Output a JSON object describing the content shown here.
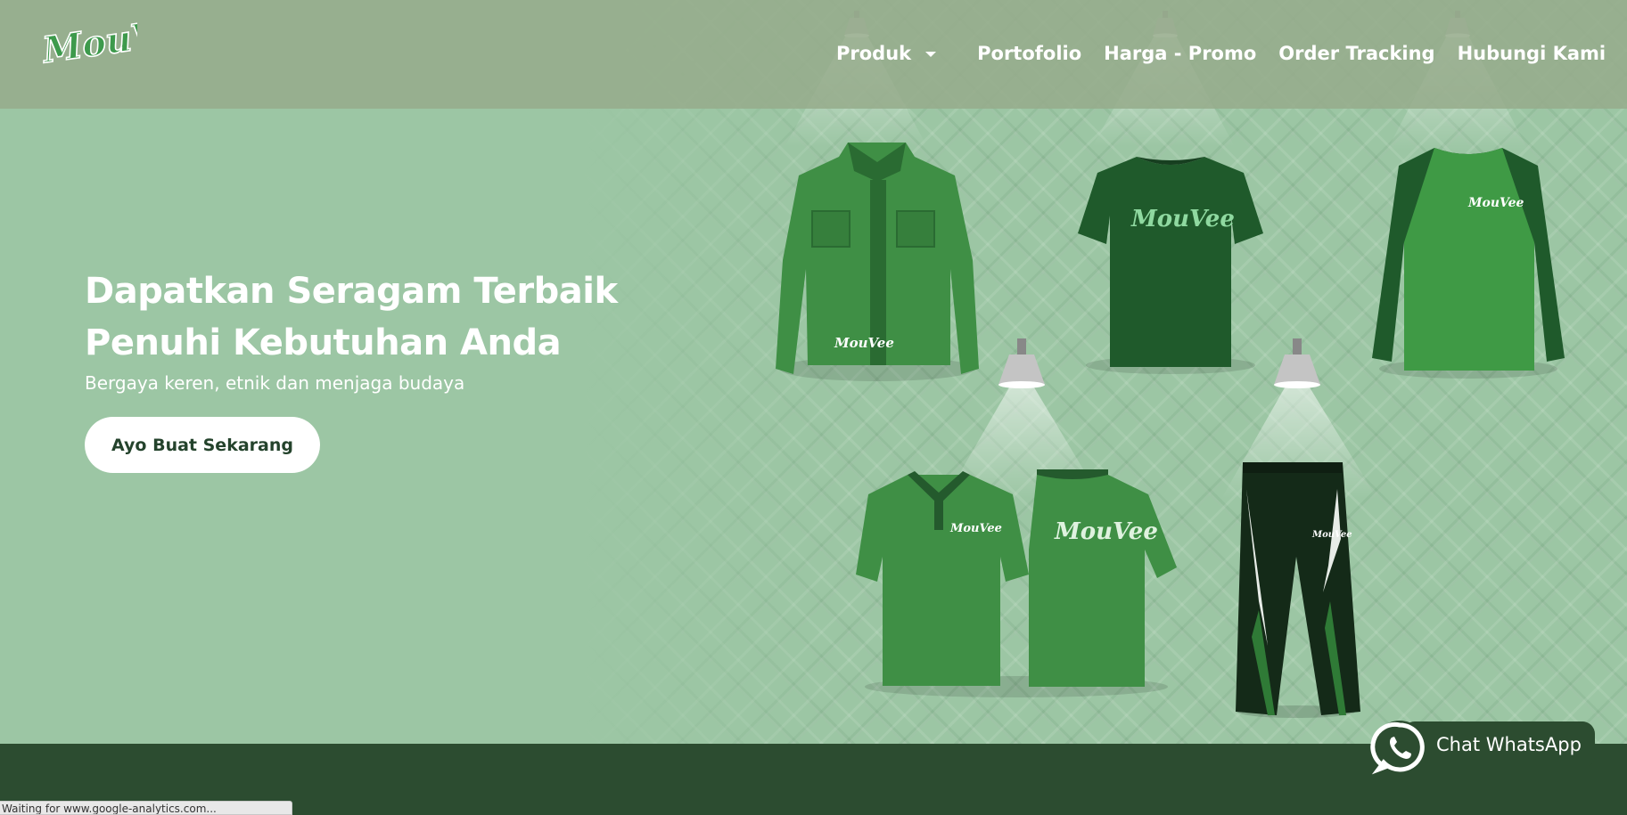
{
  "brand": {
    "logo_text": "MouVee"
  },
  "nav": {
    "items": [
      {
        "label": "Produk",
        "has_dropdown": true
      },
      {
        "label": "Portofolio"
      },
      {
        "label": "Harga - Promo"
      },
      {
        "label": "Order Tracking"
      },
      {
        "label": "Hubungi Kami"
      }
    ]
  },
  "hero": {
    "headline_line1": "Dapatkan Seragam Terbaik",
    "headline_line2": "Penuhi Kebutuhan Anda",
    "subline": "Bergaya keren, etnik dan menjaga budaya",
    "cta_label": "Ayo Buat Sekarang"
  },
  "products": {
    "print_text": "MouVee",
    "items": [
      "shirt",
      "t-shirt",
      "raglan",
      "polo",
      "pants"
    ]
  },
  "whatsapp": {
    "label": "Chat WhatsApp"
  },
  "browser_status": "Waiting for www.google-analytics.com...",
  "colors": {
    "hero_bg": "#9cc6a4",
    "header_bg": "#96ac8c",
    "footer_bg": "#2c4c30",
    "cta_text": "#24432c",
    "garment_green": "#3f8f45",
    "garment_dark": "#1f5a2b"
  }
}
